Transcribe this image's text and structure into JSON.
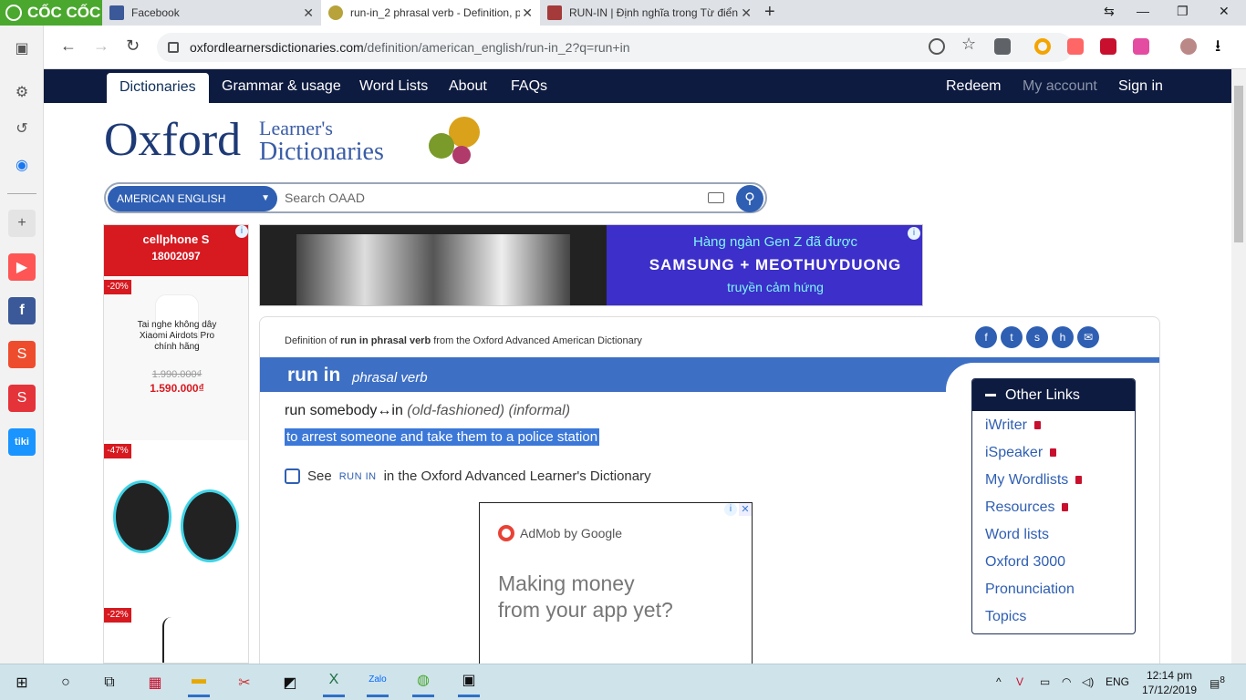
{
  "browser": {
    "logo_text": "CỐC CỐC",
    "tabs": [
      {
        "title": "Facebook",
        "icon": "facebook-icon"
      },
      {
        "title": "run-in_2 phrasal verb - Definition, p",
        "icon": "oxford-icon"
      },
      {
        "title": "RUN-IN | Định nghĩa trong Từ điển",
        "icon": "cambridge-icon"
      }
    ],
    "new_tab": "+",
    "url_host": "oxfordlearnersdictionaries.com",
    "url_path": "/definition/american_english/run-in_2?q=run+in"
  },
  "site_nav": {
    "left": [
      "Dictionaries",
      "Grammar & usage",
      "Word Lists",
      "About",
      "FAQs"
    ],
    "right": [
      "Redeem",
      "My account",
      "Sign in"
    ]
  },
  "brand": {
    "oxford": "Oxford",
    "learners": "Learner's",
    "dictionaries": "Dictionaries"
  },
  "search": {
    "dictionary": "AMERICAN ENGLISH",
    "placeholder": "Search OAAD"
  },
  "left_ad": {
    "brand": "cellphone S",
    "phone": "18002097",
    "items": [
      {
        "discount": "-20%",
        "name": "Tai nghe không dây Xiaomi Airdots Pro chính hãng",
        "old_price": "1.990.000₫",
        "new_price": "1.590.000₫"
      },
      {
        "discount": "-47%"
      },
      {
        "discount": "-22%"
      }
    ]
  },
  "banner_ad": {
    "line1": "Hàng ngàn Gen Z đã được",
    "line2": "SAMSUNG + MEOTHUYDUONG",
    "line3": "truyền cảm hứng"
  },
  "entry": {
    "crumb_pre": "Definition of ",
    "crumb_word": "run in phrasal verb",
    "crumb_post": " from the Oxford Advanced American Dictionary",
    "headword": "run in",
    "pos": "phrasal verb",
    "sense_pattern": "run somebody↔in",
    "label1": "old-fashioned",
    "label2": "informal",
    "definition": "to arrest someone and take them to a police station",
    "see_pre": "See",
    "see_word": "RUN IN",
    "see_post": "in the Oxford Advanced Learner's Dictionary"
  },
  "admob": {
    "brand": "AdMob by Google",
    "message": "Making money from your app yet?"
  },
  "other_links": {
    "title": "Other Links",
    "items": [
      {
        "label": "iWriter",
        "locked": true
      },
      {
        "label": "iSpeaker",
        "locked": true
      },
      {
        "label": "My Wordlists",
        "locked": true
      },
      {
        "label": "Resources",
        "locked": true
      },
      {
        "label": "Word lists",
        "locked": false
      },
      {
        "label": "Oxford 3000",
        "locked": false
      },
      {
        "label": "Pronunciation",
        "locked": false
      },
      {
        "label": "Topics",
        "locked": false
      }
    ]
  },
  "taskbar": {
    "lang": "ENG",
    "time": "12:14 pm",
    "date": "17/12/2019",
    "notifications": "8"
  },
  "colors": {
    "nav_band": "#0e1b40",
    "head_band": "#3d6fc4",
    "link": "#2f5fb3",
    "highlight": "#3c78d8"
  }
}
